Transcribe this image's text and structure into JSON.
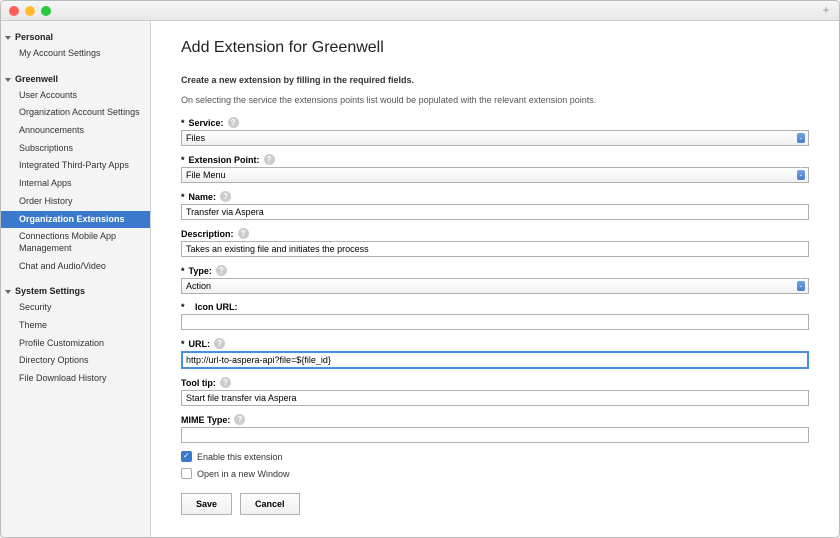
{
  "sidebar": {
    "sections": [
      {
        "title": "Personal",
        "items": [
          "My Account Settings"
        ]
      },
      {
        "title": "Greenwell",
        "items": [
          "User Accounts",
          "Organization Account Settings",
          "Announcements",
          "Subscriptions",
          "Integrated Third-Party Apps",
          "Internal Apps",
          "Order History",
          "Organization Extensions",
          "Connections Mobile App Management",
          "Chat and Audio/Video"
        ],
        "activeIndex": 7
      },
      {
        "title": "System Settings",
        "items": [
          "Security",
          "Theme",
          "Profile Customization",
          "Directory Options",
          "File Download History"
        ]
      }
    ]
  },
  "page": {
    "title": "Add Extension for Greenwell",
    "intro": "Create a new extension by filling in the required fields.",
    "hint": "On selecting the service the extensions points list would be populated with the relevant extension points."
  },
  "form": {
    "service": {
      "label": "Service:",
      "value": "Files"
    },
    "extPoint": {
      "label": "Extension Point:",
      "value": "File Menu"
    },
    "name": {
      "label": "Name:",
      "value": "Transfer via Aspera"
    },
    "description": {
      "label": "Description:",
      "value": "Takes an existing file and initiates the process"
    },
    "type": {
      "label": "Type:",
      "value": "Action"
    },
    "iconUrl": {
      "label": "Icon URL:",
      "value": ""
    },
    "url": {
      "label": "URL:",
      "value": "http://url-to-aspera-api?file=${file_id}"
    },
    "tooltip": {
      "label": "Tool tip:",
      "value": "Start file transfer via Aspera"
    },
    "mime": {
      "label": "MIME Type:",
      "value": ""
    },
    "enable": {
      "label": "Enable this extension",
      "checked": true
    },
    "newWindow": {
      "label": "Open in a new Window",
      "checked": false
    }
  },
  "buttons": {
    "save": "Save",
    "cancel": "Cancel"
  }
}
